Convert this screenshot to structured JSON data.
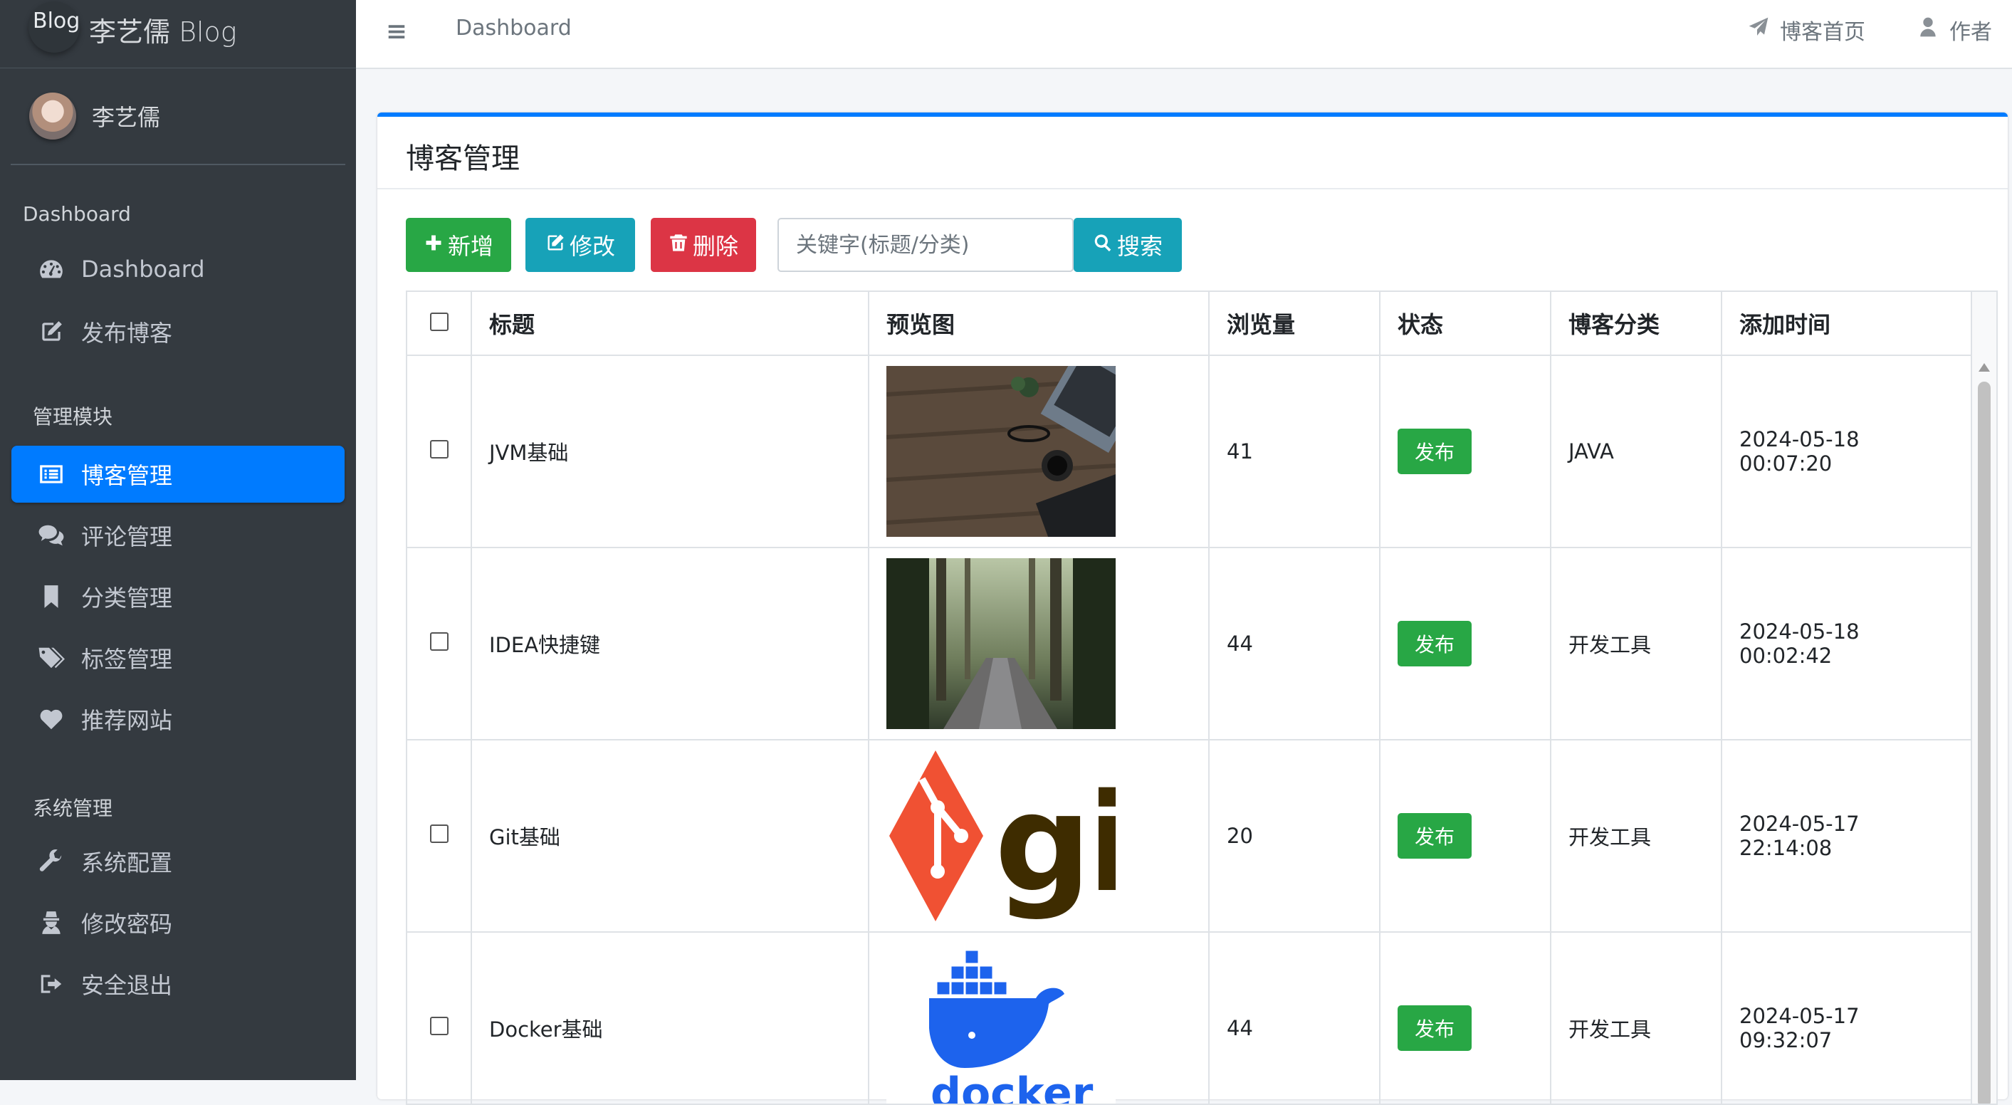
{
  "brand": {
    "logo_text": "Blog",
    "title": "李艺儒 Blog"
  },
  "user": {
    "name": "李艺儒"
  },
  "nav": {
    "section1": "Dashboard",
    "section1_items": [
      {
        "label": "Dashboard",
        "icon": "tachometer-icon"
      },
      {
        "label": "发布博客",
        "icon": "edit-icon"
      }
    ],
    "section2": "管理模块",
    "section2_items": [
      {
        "label": "博客管理",
        "icon": "list-icon",
        "active": true
      },
      {
        "label": "评论管理",
        "icon": "comments-icon"
      },
      {
        "label": "分类管理",
        "icon": "bookmark-icon"
      },
      {
        "label": "标签管理",
        "icon": "tags-icon"
      },
      {
        "label": "推荐网站",
        "icon": "heart-icon"
      }
    ],
    "section3": "系统管理",
    "section3_items": [
      {
        "label": "系统配置",
        "icon": "wrench-icon"
      },
      {
        "label": "修改密码",
        "icon": "user-secret-icon"
      },
      {
        "label": "安全退出",
        "icon": "sign-out-icon"
      }
    ]
  },
  "topbar": {
    "breadcrumb": "Dashboard",
    "home_link": "博客首页",
    "author_link": "作者"
  },
  "card": {
    "title": "博客管理"
  },
  "toolbar": {
    "add": "新增",
    "edit": "修改",
    "delete": "删除",
    "search_placeholder": "关键字(标题/分类)",
    "search": "搜索"
  },
  "table": {
    "columns": [
      "标题",
      "预览图",
      "浏览量",
      "状态",
      "博客分类",
      "添加时间"
    ],
    "rows": [
      {
        "title": "JVM基础",
        "preview": "desk-photo",
        "views": "41",
        "status": "发布",
        "category": "JAVA",
        "time": "2024-05-18 00:07:20"
      },
      {
        "title": "IDEA快捷键",
        "preview": "forest-photo",
        "views": "44",
        "status": "发布",
        "category": "开发工具",
        "time": "2024-05-18 00:02:42"
      },
      {
        "title": "Git基础",
        "preview": "git-logo",
        "views": "20",
        "status": "发布",
        "category": "开发工具",
        "time": "2024-05-17 22:14:08"
      },
      {
        "title": "Docker基础",
        "preview": "docker-logo",
        "views": "44",
        "status": "发布",
        "category": "开发工具",
        "time": "2024-05-17 09:32:07"
      }
    ]
  },
  "colors": {
    "sidebar": "#343a40",
    "primary": "#007bff",
    "success": "#28a745",
    "info": "#17a2b8",
    "danger": "#dc3545"
  }
}
